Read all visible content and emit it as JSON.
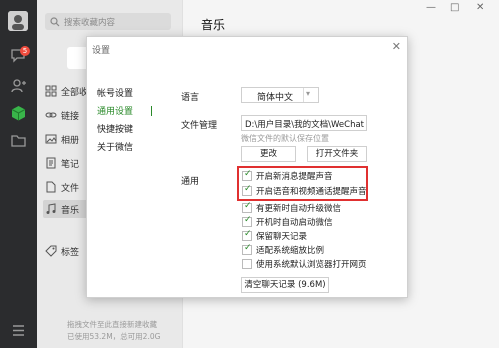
{
  "sidebar": {
    "badge": "5",
    "icons": [
      "chat-icon",
      "contacts-icon",
      "favorites-cube-icon",
      "folder-icon",
      "menu-icon"
    ]
  },
  "list": {
    "search_placeholder": "搜索收藏内容",
    "items": [
      {
        "label": "全部收",
        "icon": "grid-icon"
      },
      {
        "label": "链接",
        "icon": "link-icon"
      },
      {
        "label": "相册",
        "icon": "image-icon"
      },
      {
        "label": "笔记",
        "icon": "note-icon"
      },
      {
        "label": "文件",
        "icon": "file-icon"
      },
      {
        "label": "音乐",
        "icon": "music-icon"
      },
      {
        "label": "标签",
        "icon": "tag-icon"
      }
    ],
    "footer_line1": "拖拽文件至此直接新建收藏",
    "footer_line2": "已使用53.2M，总可用2.0G"
  },
  "main": {
    "title": "音乐",
    "window_controls": [
      "—",
      "□",
      "✕"
    ]
  },
  "dialog": {
    "title": "设置",
    "close": "✕",
    "nav": [
      {
        "label": "帐号设置",
        "active": false
      },
      {
        "label": "通用设置",
        "active": true
      },
      {
        "label": "快捷按键",
        "active": false
      },
      {
        "label": "关于微信",
        "active": false
      }
    ],
    "language_label": "语言",
    "language_value": "简体中文",
    "file_label": "文件管理",
    "file_path": "D:\\用户目录\\我的文档\\WeChat",
    "file_hint": "微信文件的默认保存位置",
    "change_button": "更改",
    "open_folder_button": "打开文件夹",
    "general_label": "通用",
    "options": [
      {
        "label": "开启新消息提醒声音",
        "checked": true
      },
      {
        "label": "开启语音和视频通话提醒声音",
        "checked": true
      },
      {
        "label": "有更新时自动升级微信",
        "checked": true
      },
      {
        "label": "开机时自动启动微信",
        "checked": true
      },
      {
        "label": "保留聊天记录",
        "checked": true
      },
      {
        "label": "适配系统缩放比例",
        "checked": true
      },
      {
        "label": "使用系统默认浏览器打开网页",
        "checked": false
      }
    ],
    "clear_button": "清空聊天记录 (9.6M)",
    "highlight_color": "#e03030"
  }
}
